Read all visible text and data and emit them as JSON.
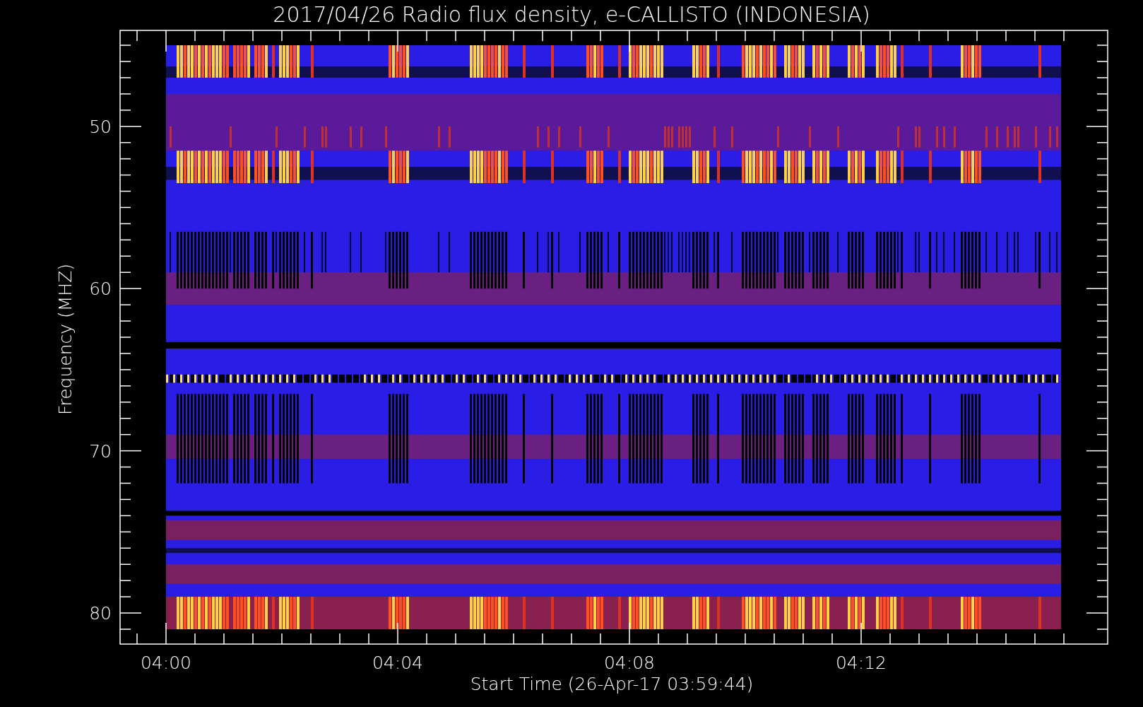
{
  "title": "2017/04/26  Radio flux density, e-CALLISTO (INDONESIA)",
  "y_axis": {
    "label": "Frequency (MHZ)",
    "ticks": [
      "50",
      "60",
      "70",
      "80"
    ]
  },
  "x_axis": {
    "label": "Start Time (26-Apr-17 03:59:44)",
    "ticks": [
      "04:00",
      "04:04",
      "04:08",
      "04:12"
    ]
  }
}
